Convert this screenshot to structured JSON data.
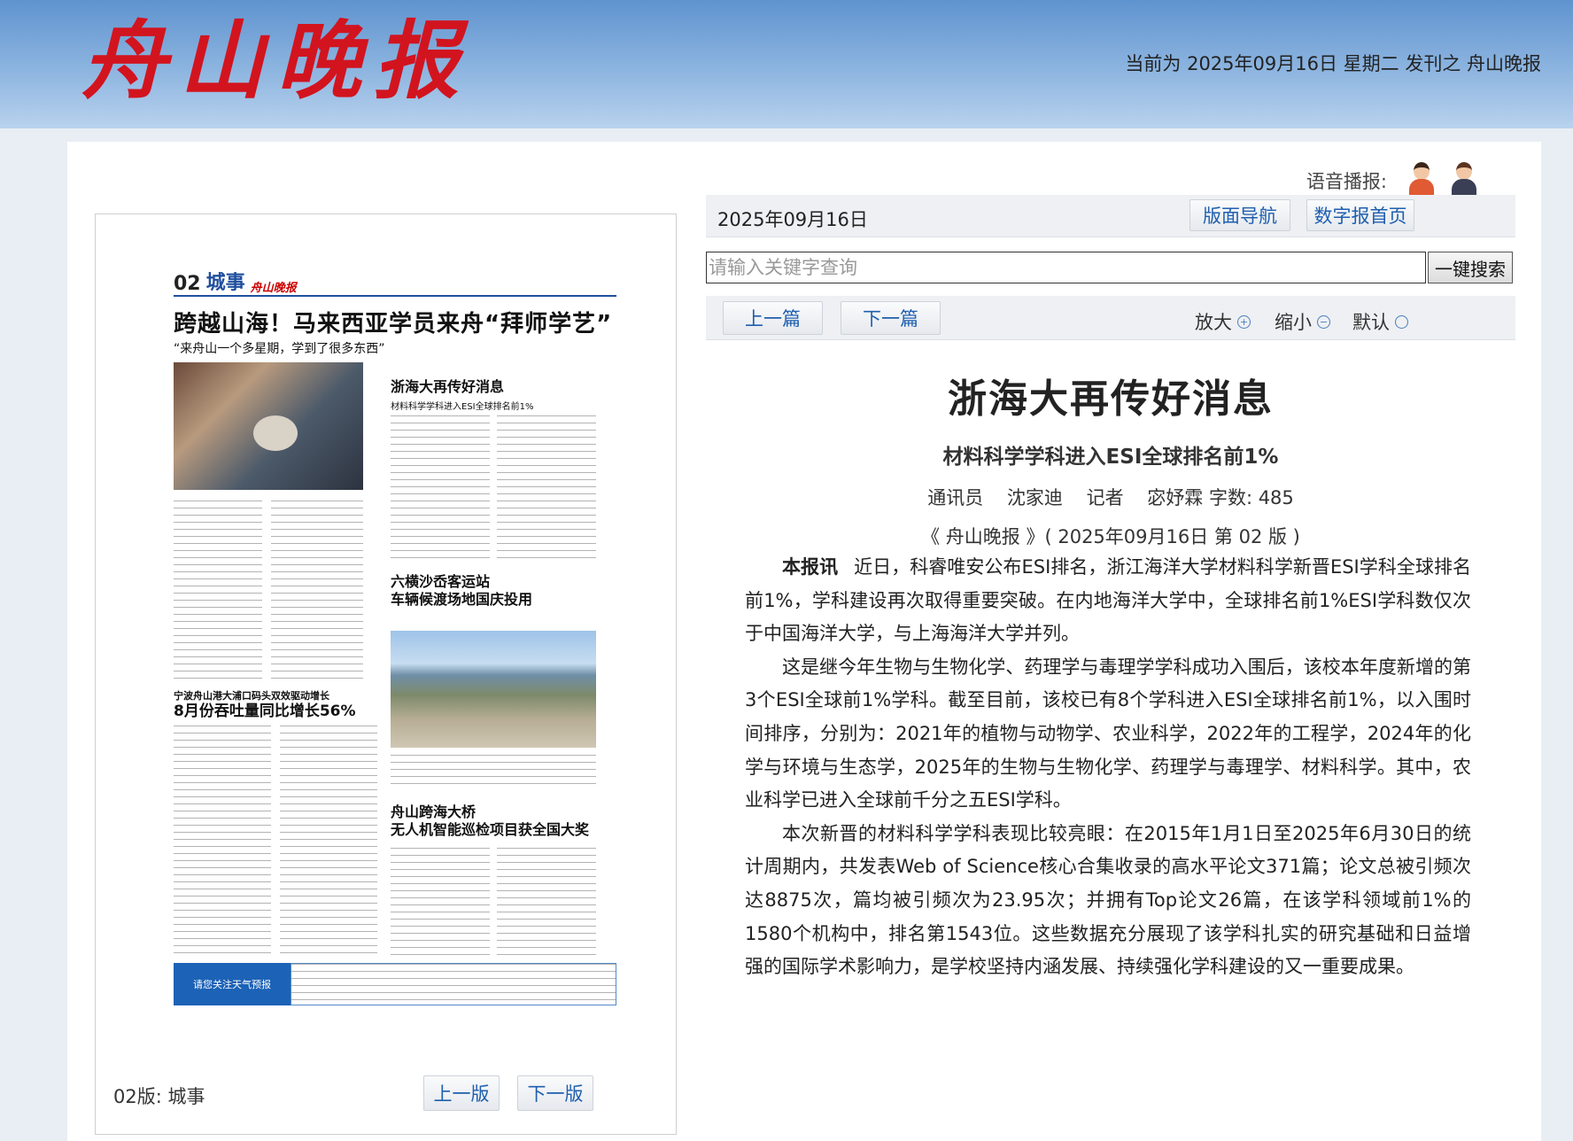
{
  "masthead": {
    "logo": "舟山晚报",
    "info": "当前为 2025年09月16日 星期二 发刊之 舟山晚报",
    "colors": {
      "logo": "#d2141f",
      "band": "#6f9fd6"
    }
  },
  "voice": {
    "label": "语音播报:",
    "icons": [
      "female-announcer-icon",
      "male-announcer-icon"
    ]
  },
  "page_preview": {
    "page_no": "02",
    "section": "城事",
    "brand": "舟山晚报",
    "headline": "跨越山海！马来西亚学员来舟“拜师学艺”",
    "headline_sub": "“来舟山一个多星期，学到了很多东西”",
    "story2_title": "浙海大再传好消息",
    "story2_sub": "材料科学学科进入ESI全球排名前1%",
    "story3_title_l1": "六横沙岙客运站",
    "story3_title_l2": "车辆候渡场地国庆投用",
    "story4_sub": "宁波舟山港大浦口码头双效驱动增长",
    "story4_title": "8月份吞吐量同比增长56%",
    "story5_title_l1": "舟山跨海大桥",
    "story5_title_l2": "无人机智能巡检项目获全国大奖",
    "weather": "请您关注天气预报",
    "label": "02版:  城事",
    "prev": "上一版",
    "next": "下一版"
  },
  "toolbar": {
    "date": "2025年09月16日",
    "layout_nav": "版面导航",
    "home": "数字报首页",
    "search_placeholder": "请输入关键字查询",
    "search_btn": "一键搜索",
    "prev_article": "上一篇",
    "next_article": "下一篇",
    "zoom_in": "放大",
    "zoom_out": "缩小",
    "zoom_default": "默认"
  },
  "article": {
    "title": "浙海大再传好消息",
    "subtitle": "材料科学学科进入ESI全球排名前1%",
    "meta": [
      "通讯员",
      "沈家迪",
      "记者",
      "宓妤霖 字数: 485"
    ],
    "source": "《 舟山晚报 》( 2025年09月16日 第 02 版 )",
    "lead": "本报讯",
    "p1": "近日，科睿唯安公布ESI排名，浙江海洋大学材料科学新晋ESI学科全球排名前1%，学科建设再次取得重要突破。在内地海洋大学中，全球排名前1%ESI学科数仅次于中国海洋大学，与上海海洋大学并列。",
    "p2": "这是继今年生物与生物化学、药理学与毒理学学科成功入围后，该校本年度新增的第3个ESI全球前1%学科。截至目前，该校已有8个学科进入ESI全球排名前1%，以入围时间排序，分别为：2021年的植物与动物学、农业科学，2022年的工程学，2024年的化学与环境与生态学，2025年的生物与生物化学、药理学与毒理学、材料科学。其中，农业科学已进入全球前千分之五ESI学科。",
    "p3": "本次新晋的材料科学学科表现比较亮眼：在2015年1月1日至2025年6月30日的统计周期内，共发表Web of Science核心合集收录的高水平论文371篇；论文总被引频次达8875次，篇均被引频次为23.95次；并拥有Top论文26篇，在该学科领域前1%的1580个机构中，排名第1543位。这些数据充分展现了该学科扎实的研究基础和日益增强的国际学术影响力，是学校坚持内涵发展、持续强化学科建设的又一重要成果。"
  }
}
